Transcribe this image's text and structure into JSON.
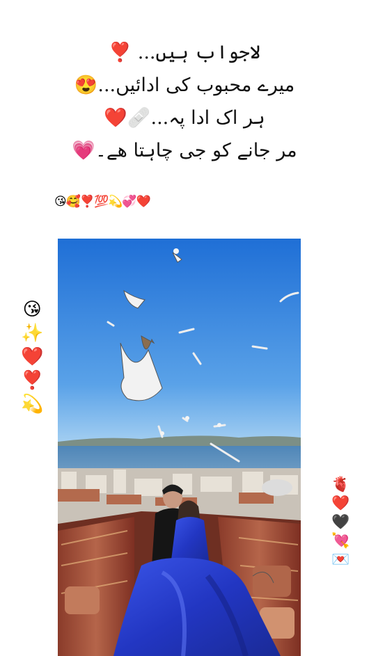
{
  "poem": {
    "lines": [
      "لاجواب ہیں... ❣️",
      "میرے محبوب کی ادائیں...😍",
      "ہر اک ادا پہ...🩹❤️",
      "مر جانے کو جی چاہتا ھے۔💗"
    ]
  },
  "emoji_row": "😘🥰❣️💯💫💞❤️",
  "left_emojis": [
    "😘",
    "✨",
    "❤️",
    "❣️",
    "💫"
  ],
  "right_emojis": [
    "🫀",
    "❤️",
    "🖤",
    "💘",
    "💌"
  ],
  "photo": {
    "description_icon": "couple-rooftop-seagulls-photo"
  },
  "colors": {
    "sky_top": "#1f6fd6",
    "sky_bottom": "#8fc4ef",
    "dress": "#2a3fd0"
  }
}
